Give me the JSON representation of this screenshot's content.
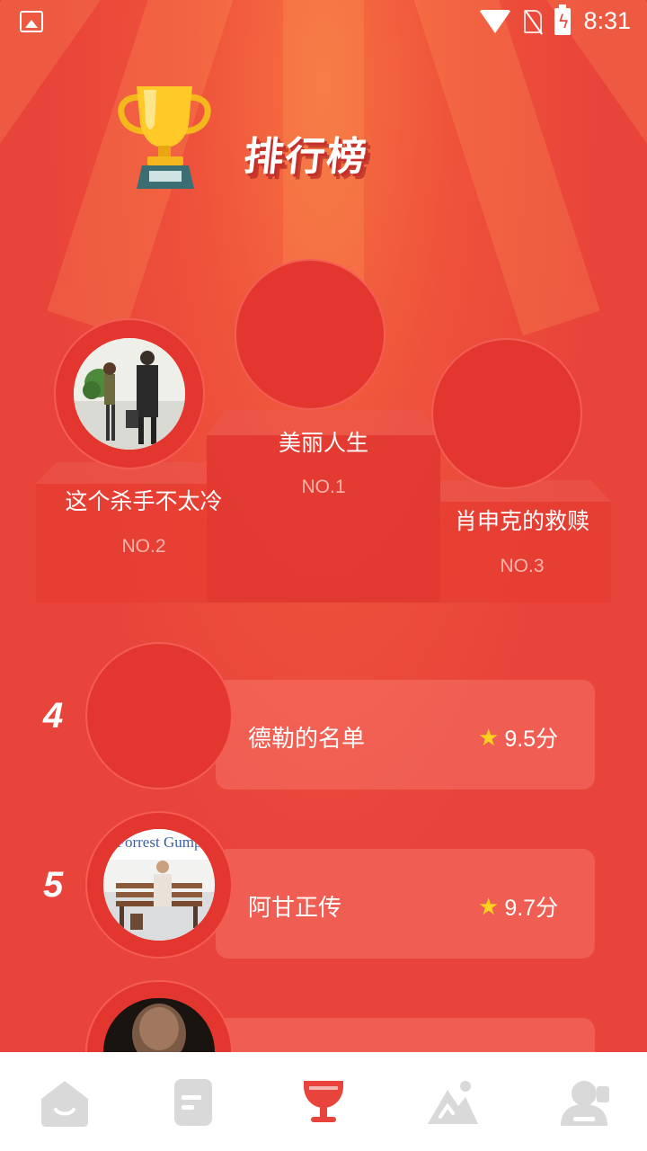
{
  "status_bar": {
    "time": "8:31"
  },
  "header": {
    "title": "排行榜"
  },
  "podium": [
    {
      "rank_label": "NO.2",
      "name": "这个杀手不太冷"
    },
    {
      "rank_label": "NO.1",
      "name": "美丽人生"
    },
    {
      "rank_label": "NO.3",
      "name": "肖申克的救赎"
    }
  ],
  "list": [
    {
      "rank": "4",
      "name": "德勒的名单",
      "score": "9.5分"
    },
    {
      "rank": "5",
      "name": "阿甘正传",
      "score": "9.7分"
    }
  ],
  "poster_text": {
    "forrest": "Forrest Gump"
  },
  "nav": [
    {
      "icon": "home-icon"
    },
    {
      "icon": "document-icon"
    },
    {
      "icon": "trophy-icon",
      "active": true
    },
    {
      "icon": "mountain-icon"
    },
    {
      "icon": "profile-icon"
    }
  ],
  "colors": {
    "background": "#E8443B",
    "active_nav": "#E8443B",
    "inactive_nav": "#D9D9D9",
    "star": "#FFD21E"
  }
}
